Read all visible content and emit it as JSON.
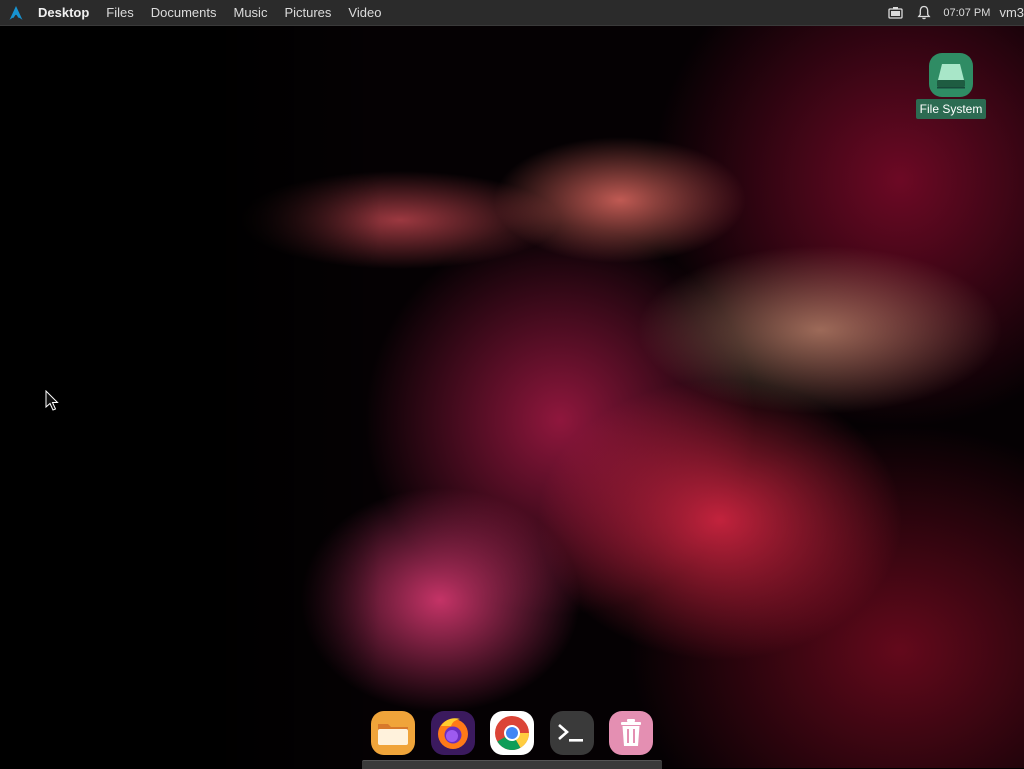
{
  "top_panel": {
    "places": [
      "Desktop",
      "Files",
      "Documents",
      "Music",
      "Pictures",
      "Video"
    ],
    "active_place": "Desktop",
    "clock": "07:07 PM",
    "user": "vm3",
    "icons": [
      "arch-logo-icon",
      "battery-icon",
      "bell-icon"
    ]
  },
  "desktop": {
    "icons": [
      {
        "label": "File System",
        "icon": "drive-icon"
      }
    ]
  },
  "dock": {
    "items": [
      {
        "name": "files",
        "icon": "folder-icon"
      },
      {
        "name": "firefox",
        "icon": "firefox-icon"
      },
      {
        "name": "chrome",
        "icon": "chrome-icon"
      },
      {
        "name": "terminal",
        "icon": "terminal-icon"
      },
      {
        "name": "trash",
        "icon": "trash-icon"
      }
    ]
  },
  "colors": {
    "panel_bg": "#2b2b2b",
    "desktop_label_bg": "#2c6b52",
    "accent": "#1793d1"
  }
}
